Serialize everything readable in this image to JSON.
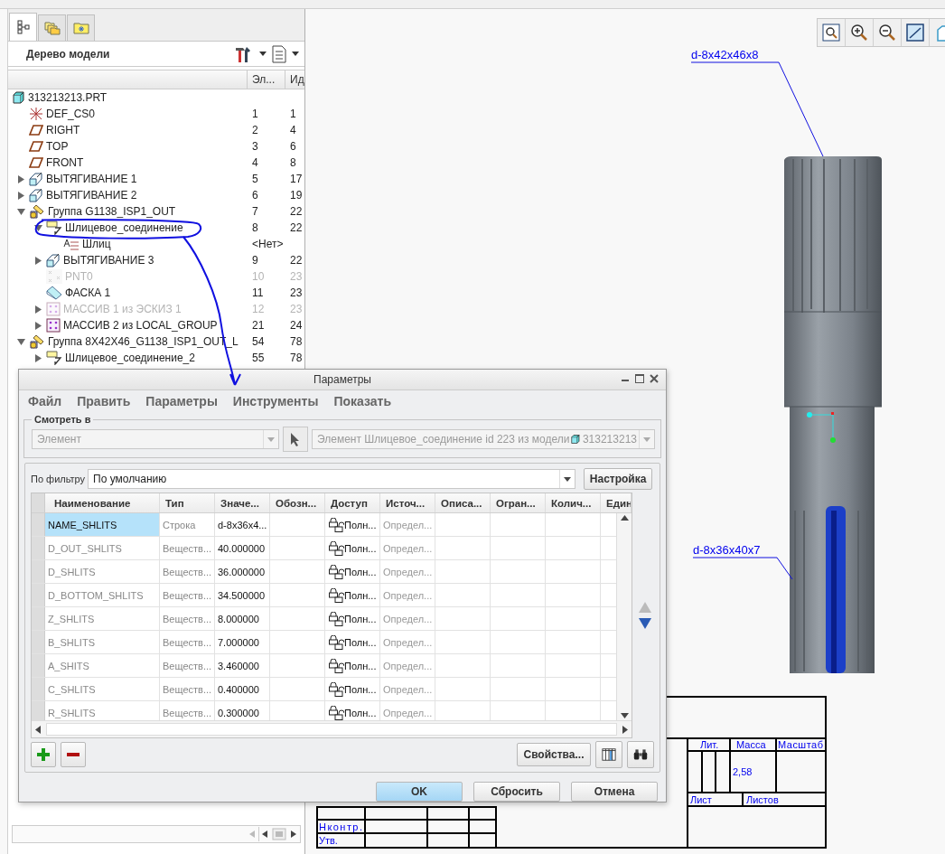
{
  "model_tree": {
    "tabs": [
      {
        "kind": "tree",
        "selected": true
      },
      {
        "kind": "folders",
        "selected": false
      },
      {
        "kind": "favorites",
        "selected": false
      }
    ],
    "title": "Дерево модели",
    "columns": [
      "Эл...",
      "Ид"
    ],
    "items": [
      {
        "name": "313213213.PRT",
        "kind": "part",
        "children": [
          {
            "name": "DEF_CS0",
            "kind": "csys",
            "values": [
              "1",
              "1"
            ]
          },
          {
            "name": "RIGHT",
            "kind": "plane",
            "values": [
              "2",
              "4"
            ]
          },
          {
            "name": "TOP",
            "kind": "plane",
            "values": [
              "3",
              "6"
            ]
          },
          {
            "name": "FRONT",
            "kind": "plane",
            "values": [
              "4",
              "8"
            ]
          },
          {
            "name": "ВЫТЯГИВАНИЕ 1",
            "kind": "extrude",
            "values": [
              "5",
              "17"
            ],
            "expanded": false
          },
          {
            "name": "ВЫТЯГИВАНИЕ 2",
            "kind": "extrude",
            "values": [
              "6",
              "19"
            ],
            "expanded": false
          },
          {
            "name": "Группа G1138_ISP1_OUT",
            "kind": "group",
            "values": [
              "7",
              "22"
            ],
            "expanded": true,
            "children": [
              {
                "name": "Шлицевое_соединение",
                "kind": "spline",
                "values": [
                  "8",
                  "22"
                ],
                "expanded": true,
                "children": [
                  {
                    "name": "Шлиц",
                    "kind": "note",
                    "values": [
                      "<Нет>"
                    ]
                  }
                ]
              },
              {
                "name": "ВЫТЯГИВАНИЕ 3",
                "kind": "extrude",
                "values": [
                  "9",
                  "22"
                ],
                "expanded": false
              },
              {
                "name": "PNT0",
                "kind": "point",
                "values": [
                  "10",
                  "23"
                ],
                "disabled": true
              },
              {
                "name": "ФАСКА 1",
                "kind": "chamfer",
                "values": [
                  "11",
                  "23"
                ]
              },
              {
                "name": "МАССИВ 1 из ЭСКИЗ 1",
                "kind": "pattern",
                "values": [
                  "12",
                  "23"
                ],
                "expanded": false,
                "disabled": true
              },
              {
                "name": "МАССИВ 2 из LOCAL_GROUP",
                "kind": "pattern",
                "values": [
                  "21",
                  "24"
                ],
                "expanded": false
              }
            ]
          },
          {
            "name": "Группа 8X42X46_G1138_ISP1_OUT_L",
            "kind": "group",
            "values": [
              "54",
              "78"
            ],
            "expanded": true,
            "children": [
              {
                "name": "Шлицевое_соединение_2",
                "kind": "spline",
                "values": [
                  "55",
                  "78"
                ],
                "expanded": false
              }
            ]
          }
        ]
      }
    ]
  },
  "view": {
    "annotations": [
      "d-8x42x46x8",
      "d-8x36x40x7"
    ]
  },
  "title_block": {
    "lit": "Лит.",
    "mass_label": "Масса",
    "scale_label": "Масштаб",
    "mass": "2,58",
    "sheet": "Лист",
    "sheets": "Листов",
    "norm_control": "Нконтр.",
    "approved": "Утв."
  },
  "dialog": {
    "title": "Параметры",
    "menu": [
      "Файл",
      "Править",
      "Параметры",
      "Инструменты",
      "Показать"
    ],
    "look_in": {
      "legend": "Смотреть в",
      "scope": {
        "value": "Элемент",
        "disabled": true
      },
      "target": {
        "value": "Элемент Шлицевое_соединение id 223 из модели",
        "model": "313213213",
        "disabled": true
      }
    },
    "filter": {
      "label": "По фильтру",
      "value": "По умолчанию",
      "button": "Настройка"
    },
    "table": {
      "columns": [
        "Наименование",
        "Тип",
        "Значе...",
        "Обозн...",
        "Доступ",
        "Источ...",
        "Описа...",
        "Огран...",
        "Колич...",
        "Един"
      ],
      "rows": [
        {
          "name": "NAME_SHLITS",
          "type": "Строка",
          "value": "d-8x36x4...",
          "access": "Полн...",
          "source": "Определ...",
          "selected": true
        },
        {
          "name": "D_OUT_SHLITS",
          "type": "Веществ...",
          "value": "40.000000",
          "access": "Полн...",
          "source": "Определ...",
          "selected": false
        },
        {
          "name": "D_SHLITS",
          "type": "Веществ...",
          "value": "36.000000",
          "access": "Полн...",
          "source": "Определ...",
          "selected": false
        },
        {
          "name": "D_BOTTOM_SHLITS",
          "type": "Веществ...",
          "value": "34.500000",
          "access": "Полн...",
          "source": "Определ...",
          "selected": false
        },
        {
          "name": "Z_SHLITS",
          "type": "Веществ...",
          "value": "8.000000",
          "access": "Полн...",
          "source": "Определ...",
          "selected": false
        },
        {
          "name": "B_SHLITS",
          "type": "Веществ...",
          "value": "7.000000",
          "access": "Полн...",
          "source": "Определ...",
          "selected": false
        },
        {
          "name": "A_SHITS",
          "type": "Веществ...",
          "value": "3.460000",
          "access": "Полн...",
          "source": "Определ...",
          "selected": false
        },
        {
          "name": "C_SHLITS",
          "type": "Веществ...",
          "value": "0.400000",
          "access": "Полн...",
          "source": "Определ...",
          "selected": false
        },
        {
          "name": "R_SHLITS",
          "type": "Веществ...",
          "value": "0.300000",
          "access": "Полн...",
          "source": "Определ...",
          "selected": false
        }
      ]
    },
    "properties_button": "Свойства...",
    "actions": [
      {
        "label": "OK",
        "default": true
      },
      {
        "label": "Сбросить",
        "default": false
      },
      {
        "label": "Отмена",
        "default": false
      }
    ]
  }
}
